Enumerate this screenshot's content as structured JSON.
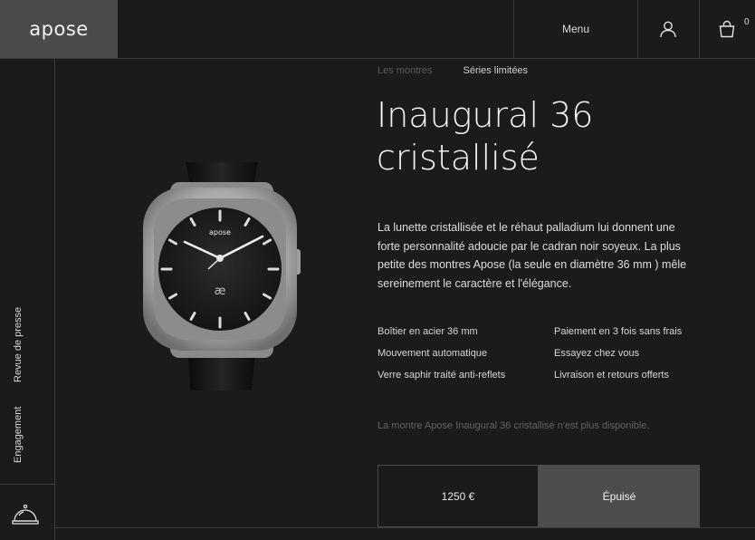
{
  "header": {
    "logo": "apose",
    "menu_label": "Menu",
    "cart_count": "0"
  },
  "sidebar": {
    "links": [
      "Revue de presse",
      "Engagement"
    ]
  },
  "breadcrumb": {
    "items": [
      "Les montres",
      "Séries limitées"
    ]
  },
  "product": {
    "title_line1": "Inaugural 36",
    "title_line2": "cristallisé",
    "description": "La lunette cristallisée et le réhaut palladium lui donnent une forte personnalité adoucie par le cadran noir soyeux. La plus petite des montres Apose (la seule en diamètre 36 mm ) mêle sereinement le caractère et l'élégance.",
    "features_left": [
      "Boîtier en acier 36 mm",
      "Mouvement automatique",
      "Verre saphir traité anti-reflets"
    ],
    "features_right": [
      "Paiement en 3 fois sans frais",
      "Essayez chez vous",
      "Livraison et retours offerts"
    ],
    "availability_note": "La montre Apose Inaugural 36 cristallisé n'est plus disponible.",
    "price": "1250 €",
    "status_button": "Épuisé",
    "dial_logo": "apose"
  },
  "icons": {
    "user": "user-icon",
    "cart": "shopping-bag-icon",
    "concierge": "service-bell-icon"
  },
  "colors": {
    "background": "#1b1b1b",
    "logo_box": "#4a4a4a",
    "soldout_button": "#4d4d4d"
  }
}
